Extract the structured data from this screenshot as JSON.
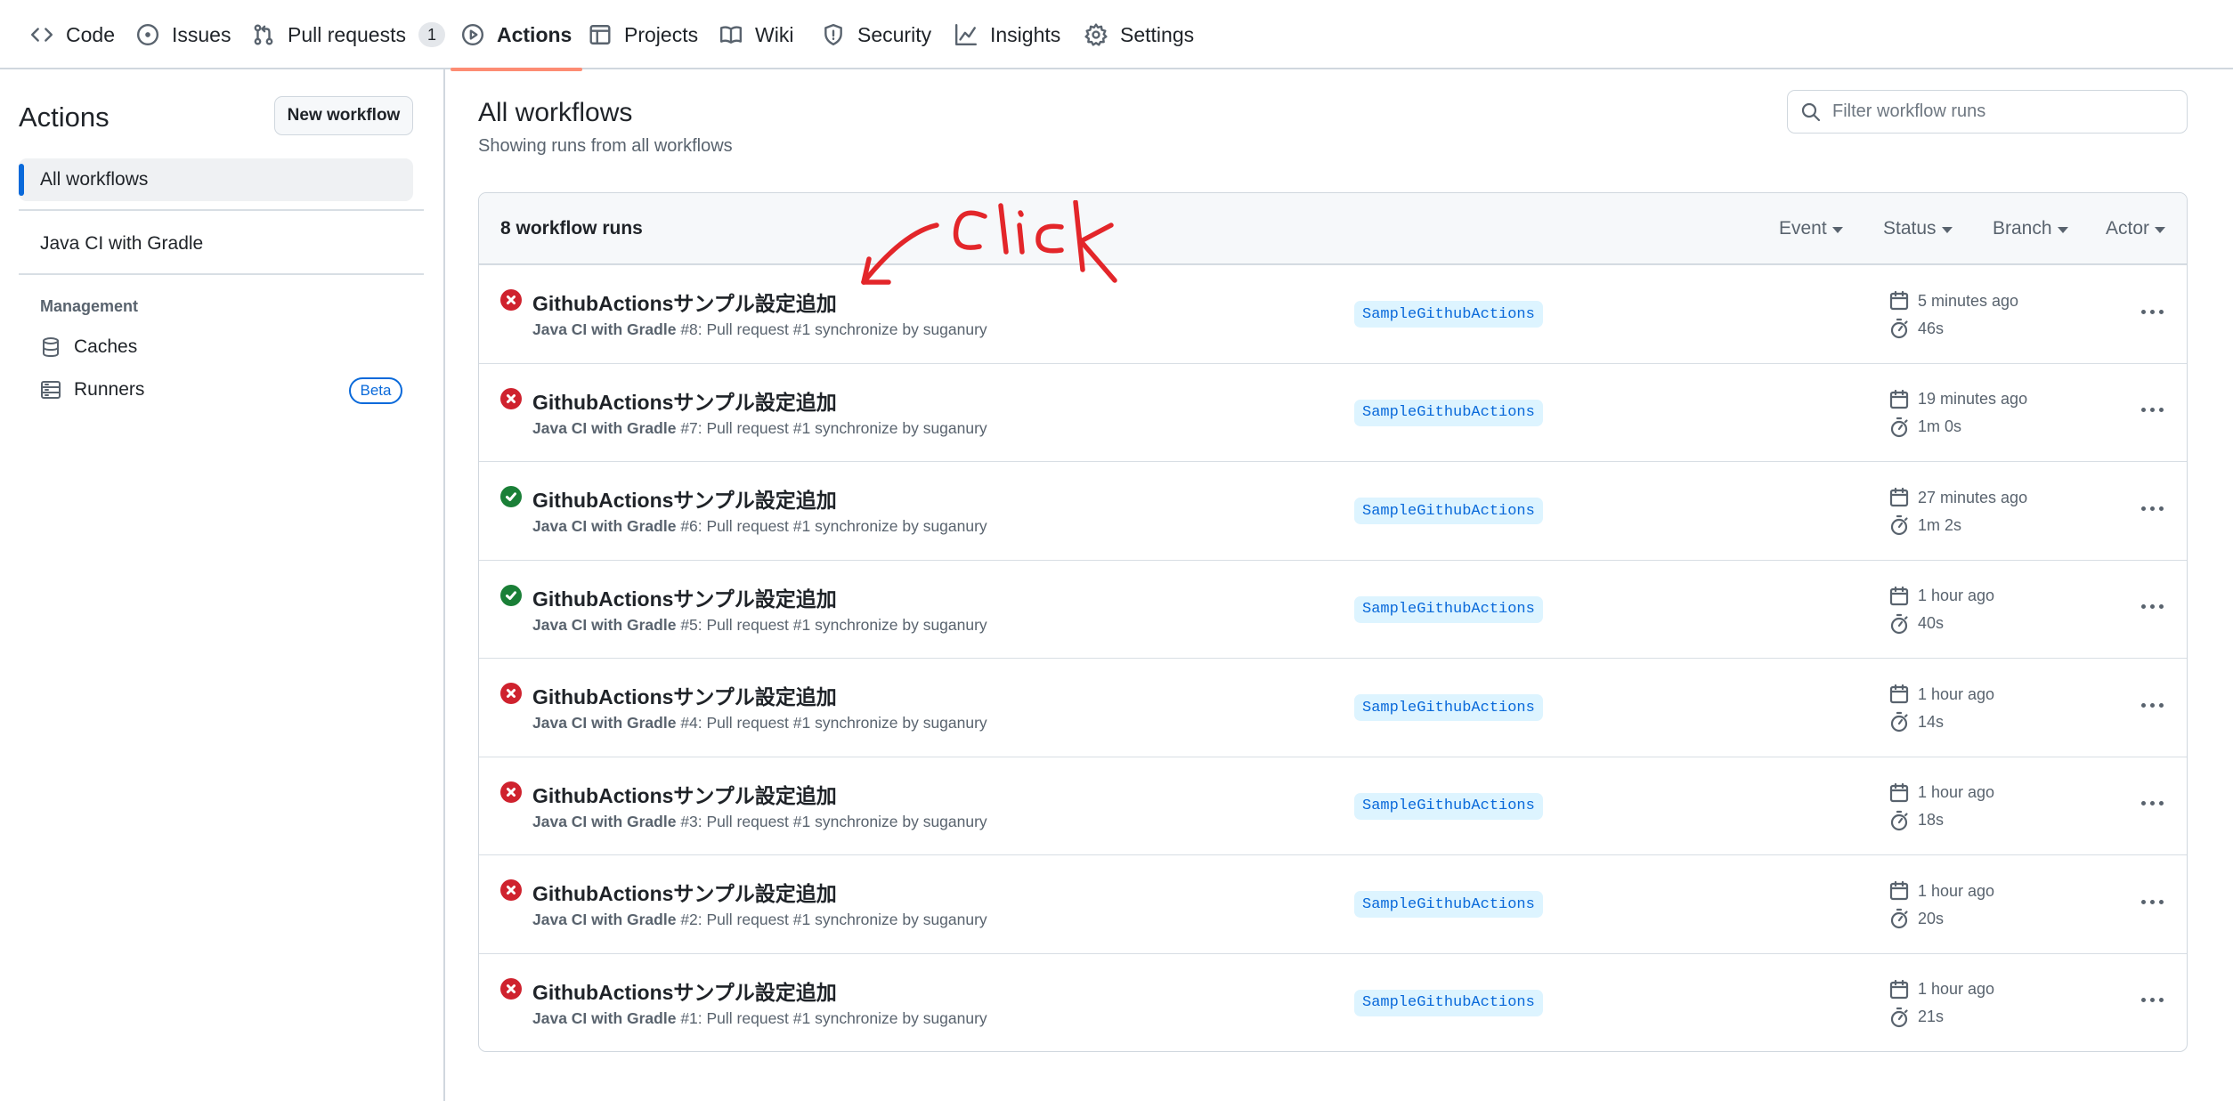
{
  "nav": {
    "items": [
      {
        "label": "Code",
        "icon": "code-icon"
      },
      {
        "label": "Issues",
        "icon": "issue-icon"
      },
      {
        "label": "Pull requests",
        "icon": "pull-request-icon",
        "count": "1"
      },
      {
        "label": "Actions",
        "icon": "play-icon",
        "active": true
      },
      {
        "label": "Projects",
        "icon": "table-icon"
      },
      {
        "label": "Wiki",
        "icon": "book-icon"
      },
      {
        "label": "Security",
        "icon": "shield-icon"
      },
      {
        "label": "Insights",
        "icon": "graph-icon"
      },
      {
        "label": "Settings",
        "icon": "gear-icon"
      }
    ]
  },
  "sidebar": {
    "title": "Actions",
    "new_workflow": "New workflow",
    "all_workflows": "All workflows",
    "workflows": [
      "Java CI with Gradle"
    ],
    "management_heading": "Management",
    "caches": "Caches",
    "runners": "Runners",
    "beta": "Beta"
  },
  "main": {
    "title": "All workflows",
    "subtitle": "Showing runs from all workflows",
    "filter_placeholder": "Filter workflow runs",
    "runs_count": "8 workflow runs",
    "filters": {
      "event": "Event",
      "status": "Status",
      "branch": "Branch",
      "actor": "Actor"
    },
    "annotation_text": "Click"
  },
  "colors": {
    "failure": "#cf222e",
    "success": "#1a7f37",
    "accent": "#0969da",
    "active_underline": "#fd8c73",
    "annotation": "#e3262a"
  },
  "runs": [
    {
      "status": "failure",
      "title": "GithubActionsサンプル設定追加",
      "workflow": "Java CI with Gradle",
      "meta": " #8: Pull request #1 synchronize by suganury",
      "branch": "SampleGithubActions",
      "when": "5 minutes ago",
      "duration": "46s"
    },
    {
      "status": "failure",
      "title": "GithubActionsサンプル設定追加",
      "workflow": "Java CI with Gradle",
      "meta": " #7: Pull request #1 synchronize by suganury",
      "branch": "SampleGithubActions",
      "when": "19 minutes ago",
      "duration": "1m 0s"
    },
    {
      "status": "success",
      "title": "GithubActionsサンプル設定追加",
      "workflow": "Java CI with Gradle",
      "meta": " #6: Pull request #1 synchronize by suganury",
      "branch": "SampleGithubActions",
      "when": "27 minutes ago",
      "duration": "1m 2s"
    },
    {
      "status": "success",
      "title": "GithubActionsサンプル設定追加",
      "workflow": "Java CI with Gradle",
      "meta": " #5: Pull request #1 synchronize by suganury",
      "branch": "SampleGithubActions",
      "when": "1 hour ago",
      "duration": "40s"
    },
    {
      "status": "failure",
      "title": "GithubActionsサンプル設定追加",
      "workflow": "Java CI with Gradle",
      "meta": " #4: Pull request #1 synchronize by suganury",
      "branch": "SampleGithubActions",
      "when": "1 hour ago",
      "duration": "14s"
    },
    {
      "status": "failure",
      "title": "GithubActionsサンプル設定追加",
      "workflow": "Java CI with Gradle",
      "meta": " #3: Pull request #1 synchronize by suganury",
      "branch": "SampleGithubActions",
      "when": "1 hour ago",
      "duration": "18s"
    },
    {
      "status": "failure",
      "title": "GithubActionsサンプル設定追加",
      "workflow": "Java CI with Gradle",
      "meta": " #2: Pull request #1 synchronize by suganury",
      "branch": "SampleGithubActions",
      "when": "1 hour ago",
      "duration": "20s"
    },
    {
      "status": "failure",
      "title": "GithubActionsサンプル設定追加",
      "workflow": "Java CI with Gradle",
      "meta": " #1: Pull request #1 synchronize by suganury",
      "branch": "SampleGithubActions",
      "when": "1 hour ago",
      "duration": "21s"
    }
  ]
}
